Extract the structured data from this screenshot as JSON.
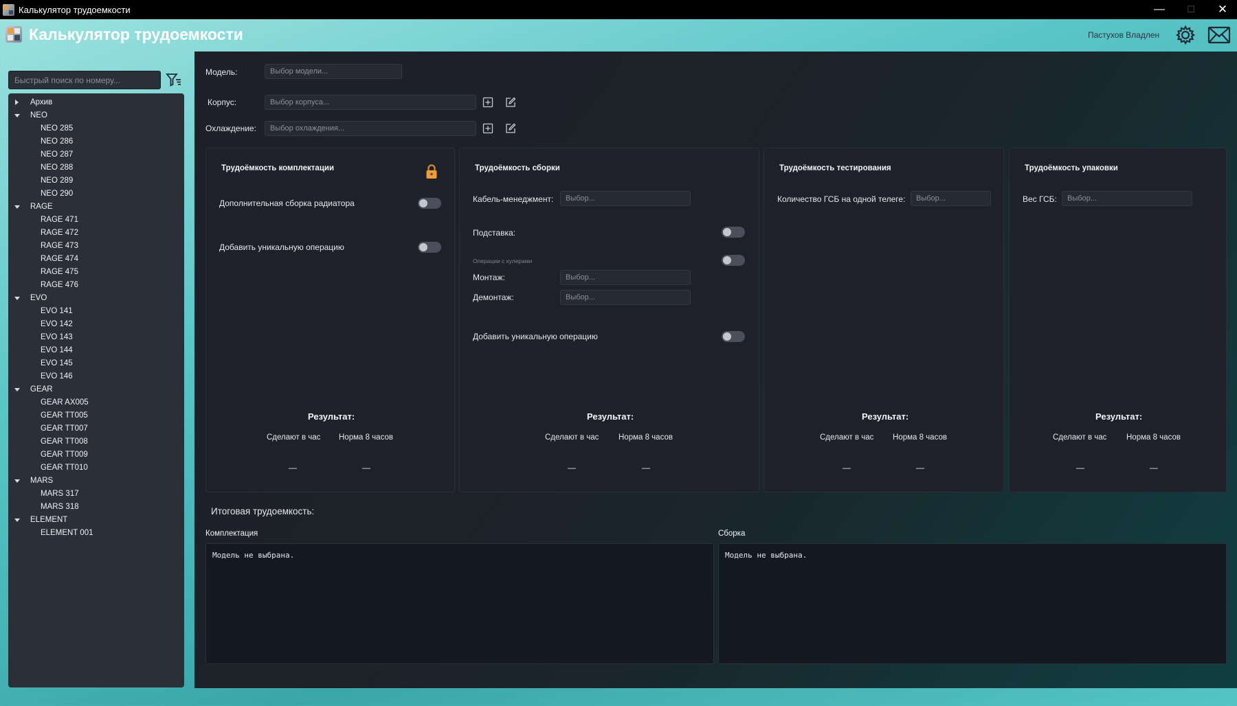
{
  "window": {
    "title": "Калькулятор трудоемкости",
    "minimize": "—",
    "maximize": "☐",
    "close": "✕"
  },
  "header": {
    "title": "Калькулятор трудоемкости",
    "user": "Пастухов Владлен"
  },
  "sidebar": {
    "search_placeholder": "Быстрый поиск по номеру...",
    "tree": [
      {
        "label": "Архив",
        "expanded": false,
        "items": []
      },
      {
        "label": "NEO",
        "expanded": true,
        "items": [
          "NEO 285",
          "NEO 286",
          "NEO 287",
          "NEO 288",
          "NEO 289",
          "NEO 290"
        ]
      },
      {
        "label": "RAGE",
        "expanded": true,
        "items": [
          "RAGE 471",
          "RAGE 472",
          "RAGE 473",
          "RAGE 474",
          "RAGE 475",
          "RAGE 476"
        ]
      },
      {
        "label": "EVO",
        "expanded": true,
        "items": [
          "EVO 141",
          "EVO 142",
          "EVO 143",
          "EVO 144",
          "EVO 145",
          "EVO 146"
        ]
      },
      {
        "label": "GEAR",
        "expanded": true,
        "items": [
          "GEAR AX005",
          "GEAR TT005",
          "GEAR TT007",
          "GEAR TT008",
          "GEAR TT009",
          "GEAR TT010"
        ]
      },
      {
        "label": "MARS",
        "expanded": true,
        "items": [
          "MARS 317",
          "MARS 318"
        ]
      },
      {
        "label": "ELEMENT",
        "expanded": true,
        "items": [
          "ELEMENT 001"
        ]
      }
    ]
  },
  "form": {
    "model_label": "Модель:",
    "model_placeholder": "Выбор модели...",
    "case_label": "Корпус:",
    "case_placeholder": "Выбор корпуса...",
    "cooling_label": "Охлаждение:",
    "cooling_placeholder": "Выбор охлаждения..."
  },
  "cards": {
    "kit": {
      "title": "Трудоёмкость комплектации",
      "radiator_label": "Дополнительная сборка радиатора",
      "unique_label": "Добавить уникальную операцию",
      "result": "Результат:",
      "per_hour": "Сделают в час",
      "norm8": "Норма 8 часов",
      "per_hour_val": "—",
      "norm8_val": "—"
    },
    "assembly": {
      "title": "Трудоёмкость сборки",
      "cable_label": "Кабель-менеджмент:",
      "cable_placeholder": "Выбор...",
      "stand_label": "Подставка:",
      "coolers_caption": "Операции с кулерами",
      "mount_label": "Монтаж:",
      "mount_placeholder": "Выбор...",
      "dismount_label": "Демонтаж:",
      "dismount_placeholder": "Выбор...",
      "unique_label": "Добавить уникальную операцию",
      "result": "Результат:",
      "per_hour": "Сделают в час",
      "norm8": "Норма 8 часов",
      "per_hour_val": "—",
      "norm8_val": "—"
    },
    "testing": {
      "title": "Трудоёмкость тестирования",
      "qty_label": "Количество ГСБ на одной телеге:",
      "qty_placeholder": "Выбор...",
      "result": "Результат:",
      "per_hour": "Сделают в час",
      "norm8": "Норма 8 часов",
      "per_hour_val": "—",
      "norm8_val": "—"
    },
    "packing": {
      "title": "Трудоёмкость упаковки",
      "weight_label": "Вес ГСБ:",
      "weight_placeholder": "Выбор...",
      "result": "Результат:",
      "per_hour": "Сделают в час",
      "norm8": "Норма 8 часов",
      "per_hour_val": "—",
      "norm8_val": "—"
    }
  },
  "totals": {
    "title": "Итоговая трудоемкость:",
    "kit_label": "Комплектация",
    "kit_text": "Модель не выбрана.",
    "assembly_label": "Сборка",
    "assembly_text": "Модель не выбрана."
  },
  "colors": {
    "accent": "#f29b3b",
    "panel": "#1e2129",
    "toggle_off": "#4a505b",
    "header_gradient": "#5bc6c8"
  }
}
